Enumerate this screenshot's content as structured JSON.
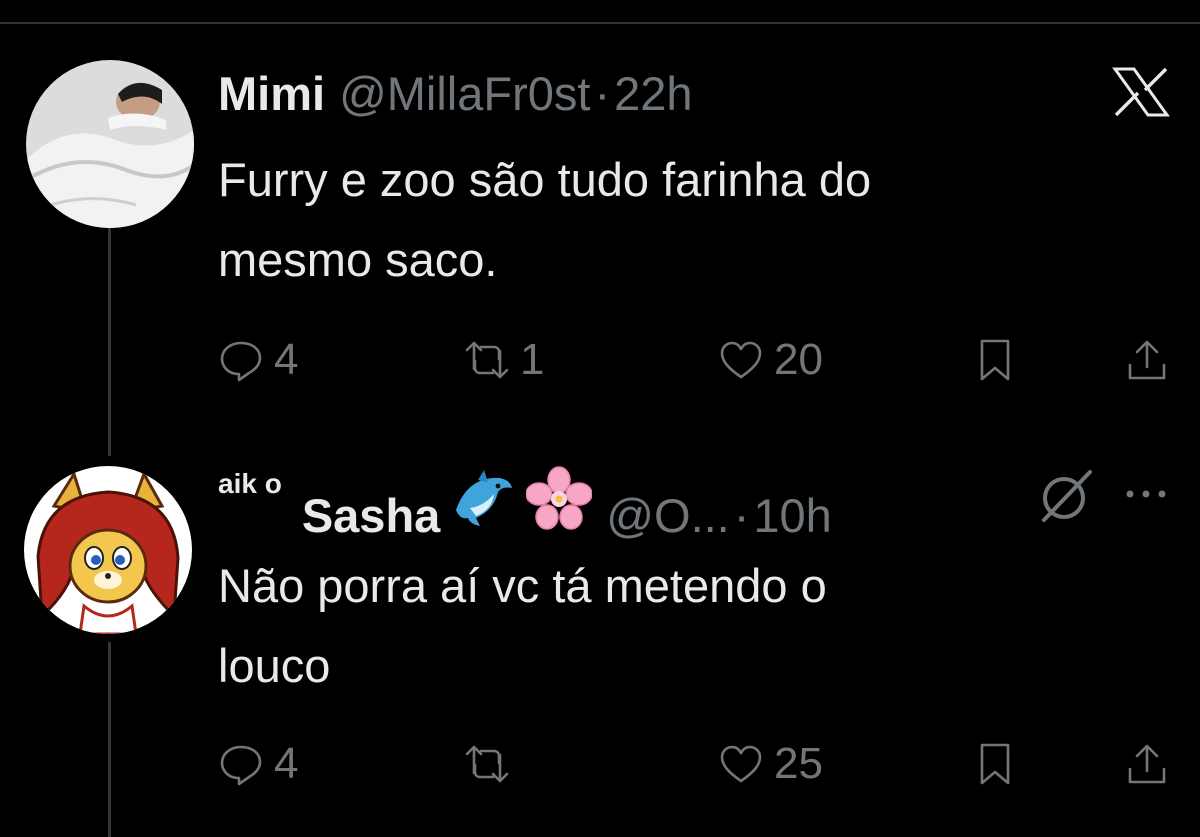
{
  "tweets": [
    {
      "name": "Mimi",
      "handle": "@MillaFr0st",
      "separator": "·",
      "time": "22h",
      "text_line1": "Furry e zoo são tudo farinha do",
      "text_line2": "mesmo saco.",
      "replies": "4",
      "retweets": "1",
      "likes": "20",
      "avatar_icon": "person-under-blanket-avatar",
      "corner_icon": "x-logo-icon"
    },
    {
      "name_prefix": "aik o",
      "name": "Sasha",
      "name_emojis": [
        "dolphin-emoji",
        "cherry-blossom-emoji"
      ],
      "handle": "@O...",
      "separator": "·",
      "time": "10h",
      "text_line1": "Não porra aí vc tá metendo o",
      "text_line2": "louco",
      "replies": "4",
      "retweets": "",
      "likes": "25",
      "avatar_icon": "cartoon-fox-avatar",
      "corner_icons": [
        "grok-icon",
        "more-options-icon"
      ]
    }
  ],
  "colors": {
    "background": "#000000",
    "primary_text": "#e7e9ea",
    "secondary_text": "#71767b",
    "divider": "#2f3336"
  }
}
